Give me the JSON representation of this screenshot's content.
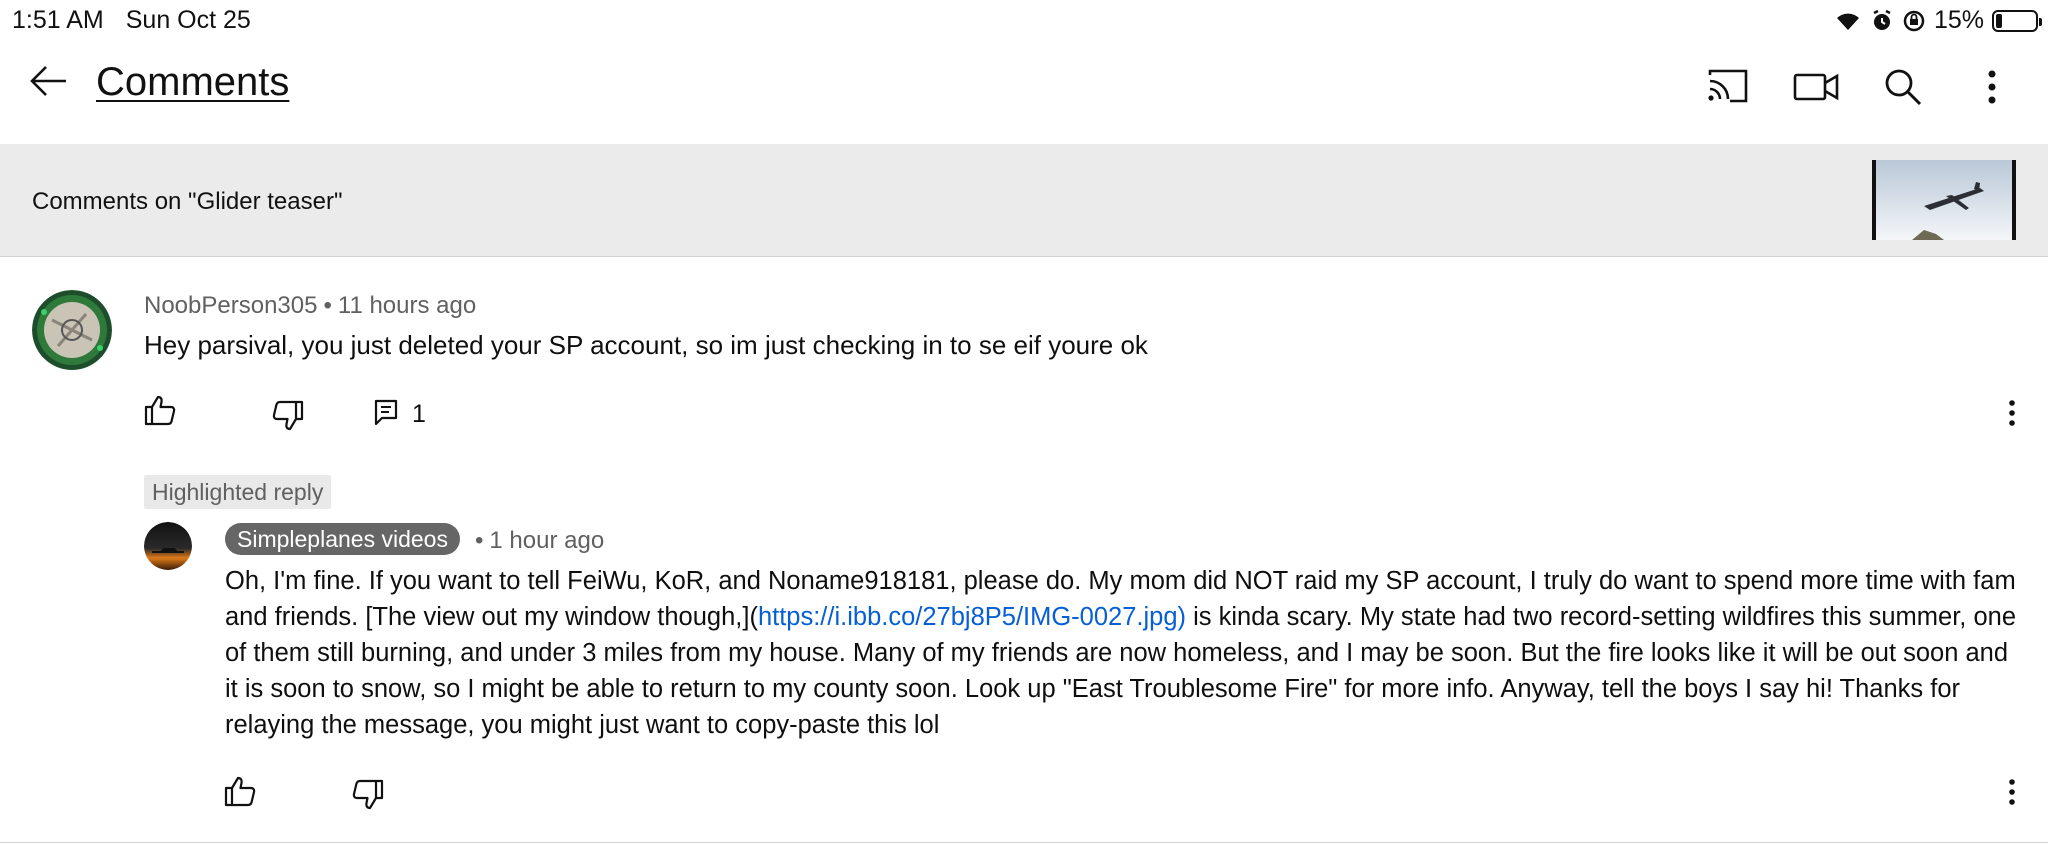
{
  "status_bar": {
    "time": "1:51 AM",
    "date": "Sun Oct 25",
    "battery_percent": "15%",
    "battery_level": 0.15,
    "icons": [
      "wifi-icon",
      "alarm-icon",
      "rotation-lock-icon"
    ]
  },
  "header": {
    "title": "Comments",
    "actions": [
      "cast-icon",
      "video-camera-icon",
      "search-icon",
      "more-vert-icon"
    ]
  },
  "video": {
    "banner_text": "Comments on \"Glider teaser\""
  },
  "comment": {
    "author": "NoobPerson305",
    "time": "11 hours ago",
    "text": "Hey parsival, you just deleted your SP account, so im just checking in to se eif youre ok",
    "reply_count": "1"
  },
  "reply": {
    "badge": "Highlighted reply",
    "author": "Simpleplanes videos",
    "time": "1 hour ago",
    "text_part1": "Oh, I'm fine. If you want to tell FeiWu, KoR, and Noname918181, please do. My mom did NOT raid my SP account, I truly do want to spend more time with fam and friends. [The view out my window though,](",
    "link": "https://i.ibb.co/27bj8P5/IMG-0027.jpg)",
    "text_part2": " is kinda scary. My state had two record-setting wildfires this summer, one of them still burning, and under 3 miles from my house. Many of my friends are now homeless, and I may be soon. But the fire looks like it will be out soon and it is soon to snow, so I might be able to return to my county soon. Look up \"East Troublesome Fire\" for more info. Anyway, tell the boys I say hi! Thanks for relaying the message, you might just want to copy-paste this lol"
  },
  "colors": {
    "link": "#065fd4",
    "banner_bg": "#ebebeb",
    "meta_text": "#606060",
    "channel_pill": "#666666"
  }
}
